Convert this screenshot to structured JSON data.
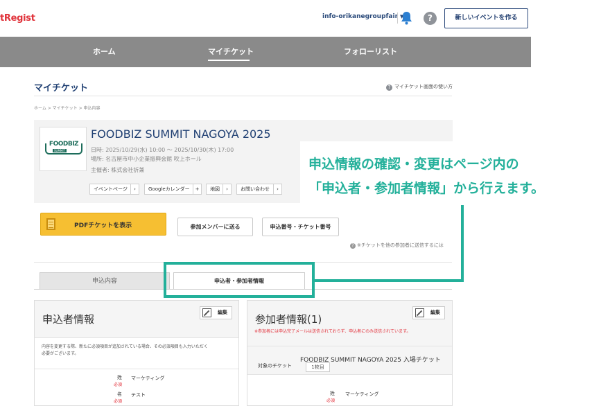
{
  "header": {
    "logo_text": "tRegist",
    "account": "info-orikanegroupfair",
    "account_caret": "▼",
    "help_label": "?",
    "create_event_label": "新しいイベントを作る"
  },
  "nav": {
    "items": [
      {
        "label": "ホーム"
      },
      {
        "label": "マイチケット"
      },
      {
        "label": "フォローリスト"
      }
    ]
  },
  "page": {
    "title": "マイチケット",
    "help_link": "マイチケット画面の使い方",
    "breadcrumb": "ホーム > マイチケット > 申込内容"
  },
  "event": {
    "logo_text": "FOODBIZ",
    "logo_sub": "SUMMIT",
    "title": "FOODBIZ SUMMIT NAGOYA 2025",
    "date": "日時: 2025/10/29(水) 10:00 ～ 2025/10/30(木) 17:00",
    "place": "場所: 名古屋市中小企業振興会館 吹上ホール",
    "organizer": "主催者: 株式会社折兼",
    "links": [
      {
        "label": "イベントページ",
        "arrow": "›"
      },
      {
        "label": "Googleカレンダー",
        "arrow": "+"
      },
      {
        "label": "地図",
        "arrow": "›"
      },
      {
        "label": "お問い合わせ",
        "arrow": "›"
      }
    ]
  },
  "actions": {
    "pdf_label": "PDFチケットを表示",
    "send_members_label": "参加メンバーに送る",
    "ticket_number_label": "申込番号・チケット番号",
    "send_note": "※チケットを他の参加者に送信するには"
  },
  "tabs": [
    {
      "label": "申込内容",
      "active": false
    },
    {
      "label": "申込者・参加者情報",
      "active": true
    }
  ],
  "applicant_panel": {
    "title": "申込者情報",
    "edit_label": "編集",
    "note_line1": "内容を変更する際、新たに必須項目が追加されている場合、その必須項目も入力いただく",
    "note_line2": "必要がございます。",
    "rows": [
      {
        "label": "姓",
        "required": "必須",
        "value": "マーケティング"
      },
      {
        "label": "名",
        "required": "必須",
        "value": "テスト"
      }
    ]
  },
  "participant_panel": {
    "title": "参加者情報(1)",
    "edit_label": "編集",
    "note": "※参加者には申込完了メールは送信されておらず、申込者にのみ送信されています。",
    "ticket_label": "対象のチケット",
    "ticket_name": "FOODBIZ SUMMIT NAGOYA 2025 入場チケット",
    "ticket_count": "1枚目",
    "rows": [
      {
        "label": "姓",
        "required": "必須",
        "value": "マーケティング"
      }
    ]
  },
  "annotation": {
    "line1": "申込情報の確認・変更はページ内の",
    "line2": "「申込者・参加者情報」から行えます。"
  },
  "colors": {
    "nav_bg": "#8a8a8a",
    "primary_blue": "#1f3f72",
    "accent_yellow": "#f6bf32",
    "annotation_teal": "#23b09a",
    "required_red": "#e2313b"
  }
}
